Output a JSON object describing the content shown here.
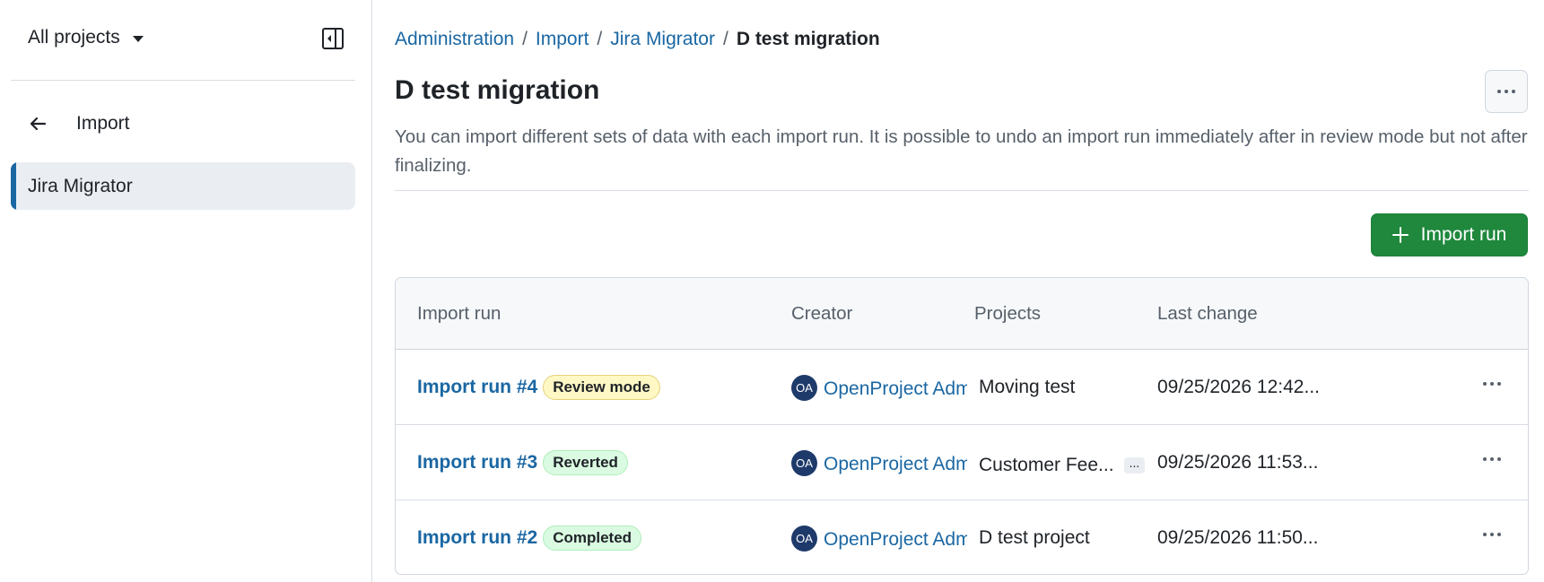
{
  "sidebar": {
    "project_switcher": "All projects",
    "back_label": "Import",
    "active_item": "Jira Migrator"
  },
  "breadcrumb": {
    "items": [
      "Administration",
      "Import",
      "Jira Migrator"
    ],
    "current": "D test migration"
  },
  "page": {
    "title": "D test migration",
    "description": "You can import different sets of data with each import run. It is possible to undo an import run immediately after in review mode but not after finalizing.",
    "import_run_button": "Import run"
  },
  "table": {
    "headers": [
      "Import run",
      "Creator",
      "Projects",
      "Last change"
    ],
    "rows": [
      {
        "run": "Import run #4",
        "status": "Review mode",
        "avatar": "OA",
        "creator": "OpenProject Admin",
        "project": "Moving test",
        "last_change": "09/25/2026 12:42..."
      },
      {
        "run": "Import run #3",
        "status": "Reverted",
        "avatar": "OA",
        "creator": "OpenProject Admin",
        "project": "Customer Fee...",
        "project_more": "...",
        "last_change": "09/25/2026 11:53..."
      },
      {
        "run": "Import run #2",
        "status": "Completed",
        "avatar": "OA",
        "creator": "OpenProject Admin",
        "project": "D test project",
        "last_change": "09/25/2026 11:50..."
      }
    ]
  },
  "colors": {
    "link": "#1a67a3",
    "primary_button": "#1f883d",
    "review_badge": "#fff8c5",
    "success_badge": "#dafbe1",
    "avatar": "#1e3a6b"
  },
  "icons": {
    "project_switcher": "chevron-down-icon",
    "collapse": "sidebar-collapse-icon",
    "back": "arrow-left-icon",
    "add": "plus-icon",
    "more": "kebab-horizontal-icon"
  }
}
